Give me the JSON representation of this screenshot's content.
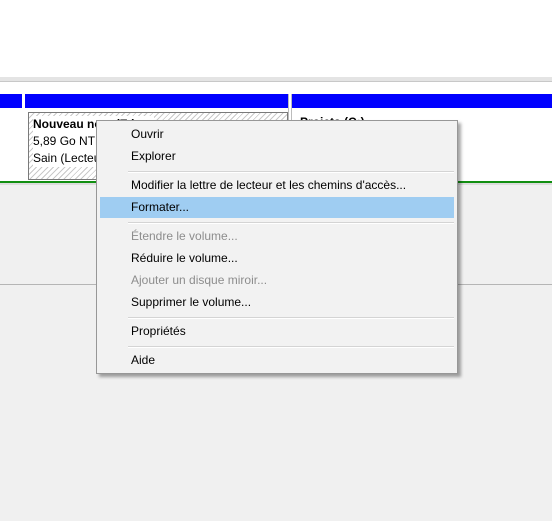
{
  "disk_view": {
    "volume_e": {
      "name": "Nouveau nom (E:)",
      "size": "5,89 Go NTFS",
      "status": "Sain (Lecteur logique)"
    },
    "volume_c": {
      "name": "Projets (C:)"
    }
  },
  "context_menu": {
    "items": [
      {
        "label": "Ouvrir"
      },
      {
        "label": "Explorer"
      },
      {
        "label": "Modifier la lettre de lecteur et les chemins d'accès..."
      },
      {
        "label": "Formater..."
      },
      {
        "label": "Étendre le volume..."
      },
      {
        "label": "Réduire le volume..."
      },
      {
        "label": "Ajouter un disque miroir..."
      },
      {
        "label": "Supprimer le volume..."
      },
      {
        "label": "Propriétés"
      },
      {
        "label": "Aide"
      }
    ],
    "highlighted": "Formater...",
    "disabled": [
      "Étendre le volume...",
      "Ajouter un disque miroir..."
    ]
  },
  "colors": {
    "volume_bar": "#0000ff",
    "status_line": "#118f11",
    "menu_highlight": "#9fcdf2",
    "disabled_text": "#8d8d8d"
  }
}
